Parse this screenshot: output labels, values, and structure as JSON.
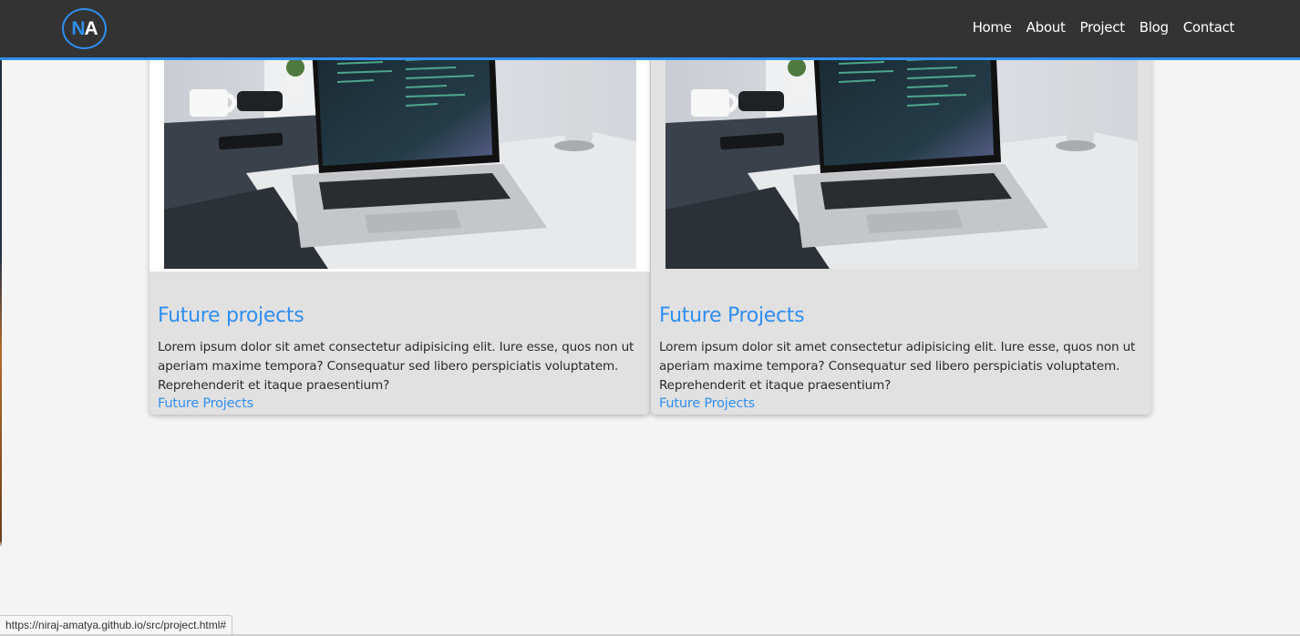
{
  "logo": {
    "letter1": "N",
    "letter2": "A"
  },
  "nav": {
    "items": [
      {
        "label": "Home"
      },
      {
        "label": "About"
      },
      {
        "label": "Project"
      },
      {
        "label": "Blog"
      },
      {
        "label": "Contact"
      }
    ]
  },
  "cards": [
    {
      "title": "Future projects",
      "description": "Lorem ipsum dolor sit amet consectetur adipisicing elit. Iure esse, quos non ut aperiam maxime tempora? Consequatur sed libero perspiciatis voluptatem. Reprehenderit et itaque praesentium?",
      "link": "Future Projects"
    },
    {
      "title": "Future Projects",
      "description": "Lorem ipsum dolor sit amet consectetur adipisicing elit. Iure esse, quos non ut aperiam maxime tempora? Consequatur sed libero perspiciatis voluptatem. Reprehenderit et itaque praesentium?",
      "link": "Future Projects"
    }
  ],
  "status_bar": {
    "url": "https://niraj-amatya.github.io/src/project.html#"
  },
  "colors": {
    "navbar": "#333333",
    "accent": "#2f8ef0",
    "card": "#e1e1e1",
    "page": "#f4f4f4"
  },
  "icons": {
    "card_image": "laptop-desk-photo"
  }
}
